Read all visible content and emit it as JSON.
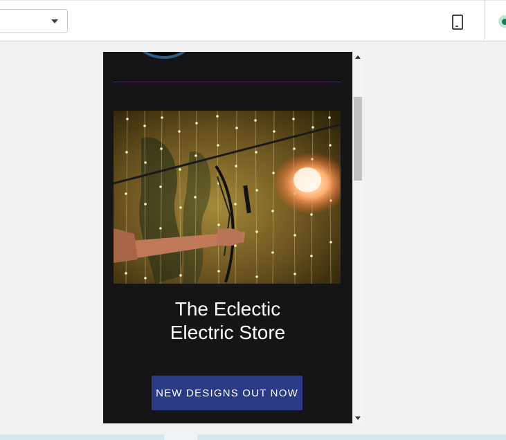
{
  "toolbar": {
    "device_select_value": "",
    "device_icon": "phone-icon",
    "status_color": "#1e7a55"
  },
  "preview": {
    "store_title": "The Eclectic Electric Store",
    "cta_label": "NEW DESIGNS OUT NOW",
    "cta_color": "#2b3a85",
    "background": "#151517"
  }
}
